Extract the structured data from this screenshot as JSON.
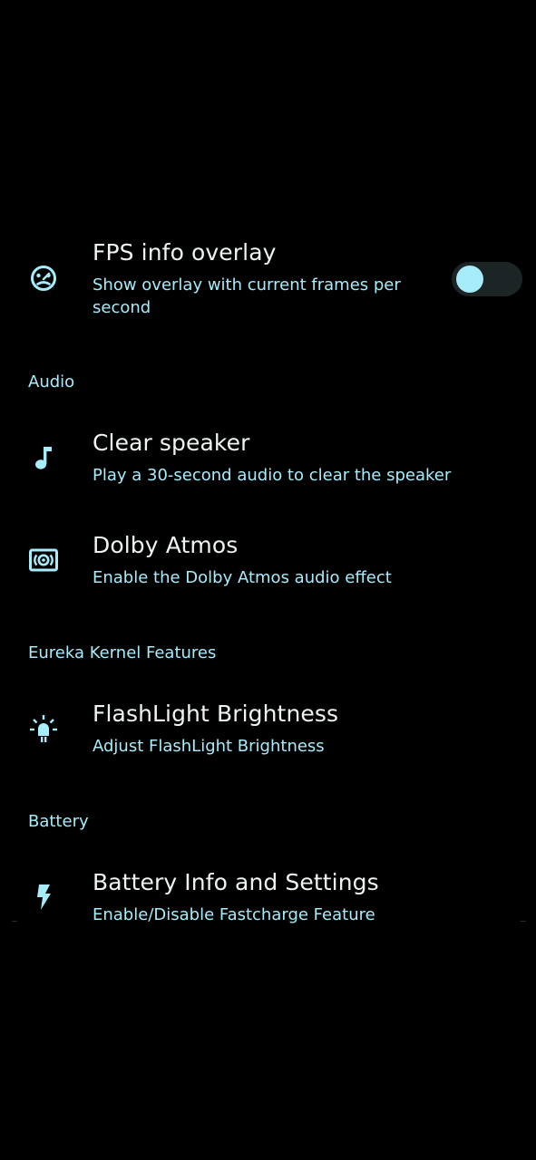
{
  "colors": {
    "background": "#000000",
    "accent": "#a6ecfb",
    "title": "#eef3f4",
    "switch_track_off": "#1d2426",
    "switch_thumb": "#a6ecfb"
  },
  "fps_overlay": {
    "icon": "speedometer-face-icon",
    "title": "FPS info overlay",
    "summary": "Show overlay with current frames per second",
    "toggle_on": false
  },
  "sections": {
    "audio": {
      "header": "Audio",
      "clear_speaker": {
        "icon": "music-note-icon",
        "title": "Clear speaker",
        "summary": "Play a 30-second audio to clear the speaker"
      },
      "dolby_atmos": {
        "icon": "surround-sound-icon",
        "title": "Dolby Atmos",
        "summary": "Enable the Dolby Atmos audio effect"
      }
    },
    "kernel": {
      "header": "Eureka Kernel Features",
      "flashlight": {
        "icon": "flashlight-bulb-icon",
        "title": "FlashLight Brightness",
        "summary": "Adjust FlashLight Brightness"
      }
    },
    "battery": {
      "header": "Battery",
      "battery_info": {
        "icon": "lightning-bolt-icon",
        "title": "Battery Info and Settings",
        "summary": "Enable/Disable Fastcharge Feature"
      }
    }
  }
}
